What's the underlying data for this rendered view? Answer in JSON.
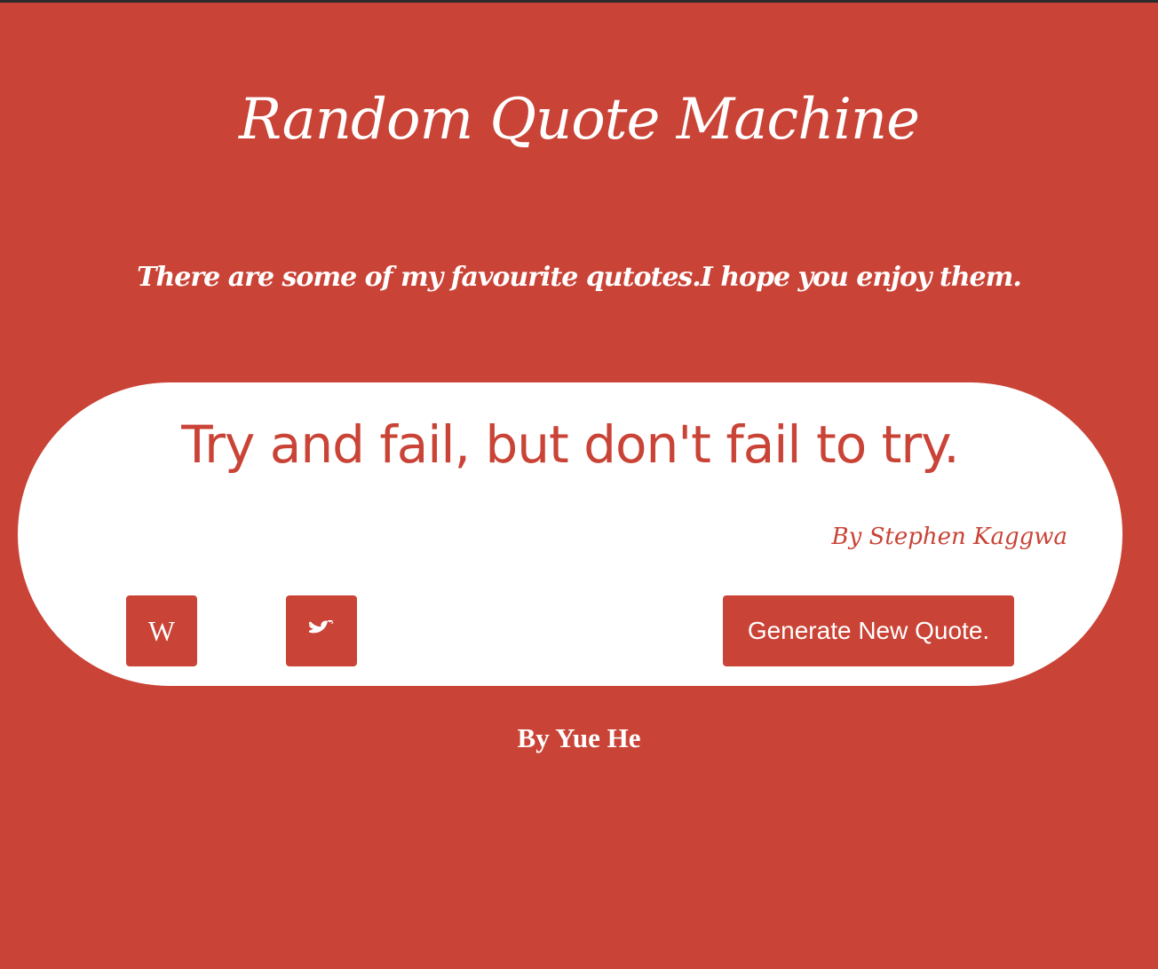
{
  "header": {
    "title": "Random Quote Machine",
    "subtitle": "There are some of my favourite qutotes.I hope you enjoy them."
  },
  "quote": {
    "text": "Try and fail, but don't fail to try.",
    "author": "By Stephen Kaggwa"
  },
  "actions": {
    "wiki_label": "W",
    "wiki_icon": "wikipedia-icon",
    "tweet_icon": "twitter-icon",
    "generate_label": "Generate New Quote."
  },
  "footer": {
    "credit": "By Yue He"
  },
  "colors": {
    "background": "#c94336",
    "card": "#ffffff",
    "accent": "#c94336"
  }
}
